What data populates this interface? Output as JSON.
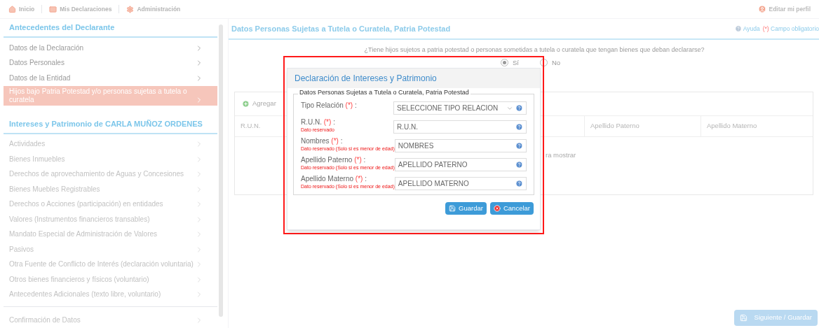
{
  "top_nav": [
    {
      "label": "Inicio",
      "kind": "home"
    },
    {
      "label": "Mis Declaraciones",
      "kind": "inbox"
    },
    {
      "label": "Administración",
      "kind": "gear"
    }
  ],
  "profile_link": "Editar mi perfil",
  "sidebar": {
    "sections": [
      {
        "title": "Antecedentes del Declarante",
        "items": [
          {
            "label": "Datos de la Declaración",
            "selected": false,
            "disabled": false
          },
          {
            "label": "Datos Personales",
            "selected": false,
            "disabled": false
          },
          {
            "label": "Datos de la Entidad",
            "selected": false,
            "disabled": false
          },
          {
            "label": "Hijos bajo Patria Potestad y/o personas sujetas a tutela o curatela",
            "selected": true,
            "disabled": false
          }
        ]
      },
      {
        "title": "Intereses y Patrimonio de CARLA MUÑOZ ORDENES",
        "items": [
          {
            "label": "Actividades",
            "selected": false,
            "disabled": true
          },
          {
            "label": "Bienes Inmuebles",
            "selected": false,
            "disabled": true
          },
          {
            "label": "Derechos de aprovechamiento de Aguas y Concesiones",
            "selected": false,
            "disabled": true
          },
          {
            "label": "Bienes Muebles Registrables",
            "selected": false,
            "disabled": true
          },
          {
            "label": "Derechos o Acciones (participación) en entidades",
            "selected": false,
            "disabled": true
          },
          {
            "label": "Valores (Instrumentos financieros transables)",
            "selected": false,
            "disabled": true
          },
          {
            "label": "Mandato Especial de Administración de Valores",
            "selected": false,
            "disabled": true
          },
          {
            "label": "Pasivos",
            "selected": false,
            "disabled": true
          },
          {
            "label": "Otra Fuente de Conflicto de Interés (declaración voluntaria)",
            "selected": false,
            "disabled": true
          },
          {
            "label": "Otros bienes financieros y físicos (voluntario)",
            "selected": false,
            "disabled": true
          },
          {
            "label": "Antecedentes Adicionales (texto libre, voluntario)",
            "selected": false,
            "disabled": true
          }
        ]
      },
      {
        "items": [
          {
            "label": "Confirmación de Datos",
            "selected": false,
            "disabled": true
          }
        ]
      }
    ]
  },
  "panel": {
    "title": "Datos Personas Sujetas a Tutela o Curatela, Patria Potestad",
    "help": "Ayuda",
    "required_mark": "(*)",
    "required_note": "Campo obligatorio",
    "question": "¿Tiene hijos sujetos a patria potestad o personas sometidas a tutela o curatela que tengan bienes que deban declararse?",
    "options": [
      {
        "label": "Sí",
        "selected": true
      },
      {
        "label": "No",
        "selected": false
      }
    ],
    "add_button": "Agregar",
    "columns": [
      "R.U.N.",
      "Apellido Paterno",
      "Apellido Materno"
    ],
    "empty_text": "ra mostrar",
    "next_button": {
      "label": "Siguiente / Guardar",
      "disabled": true
    }
  },
  "dialog": {
    "title": "Declaración de Intereses y Patrimonio",
    "legend": "Datos Personas Sujetas a Tutela o Curatela, Patria Potestad",
    "fields": [
      {
        "label": "Tipo Relación",
        "required": "(*)",
        "kind": "select",
        "value": "SELECCIONE TIPO RELACION"
      },
      {
        "label": "R.U.N.",
        "required": "(*)",
        "kind": "text",
        "note": "Dato reservado",
        "value": "R.U.N."
      },
      {
        "label": "Nombres",
        "required": "(*)",
        "kind": "text",
        "note": "Dato reservado (Solo si es menor de edad)",
        "value": "NOMBRES"
      },
      {
        "label": "Apellido Paterno",
        "required": "(*)",
        "kind": "text",
        "note": "Dato reservado (Solo si es menor de edad)",
        "value": "APELLIDO PATERNO"
      },
      {
        "label": "Apellido Materno",
        "required": "(*)",
        "kind": "text",
        "note": "Dato reservado (Solo si es menor de edad)",
        "value": "APELLIDO MATERNO"
      }
    ],
    "label_suffix": ":",
    "save_button": "Guardar",
    "cancel_button": "Cancelar",
    "highlighted": true
  }
}
